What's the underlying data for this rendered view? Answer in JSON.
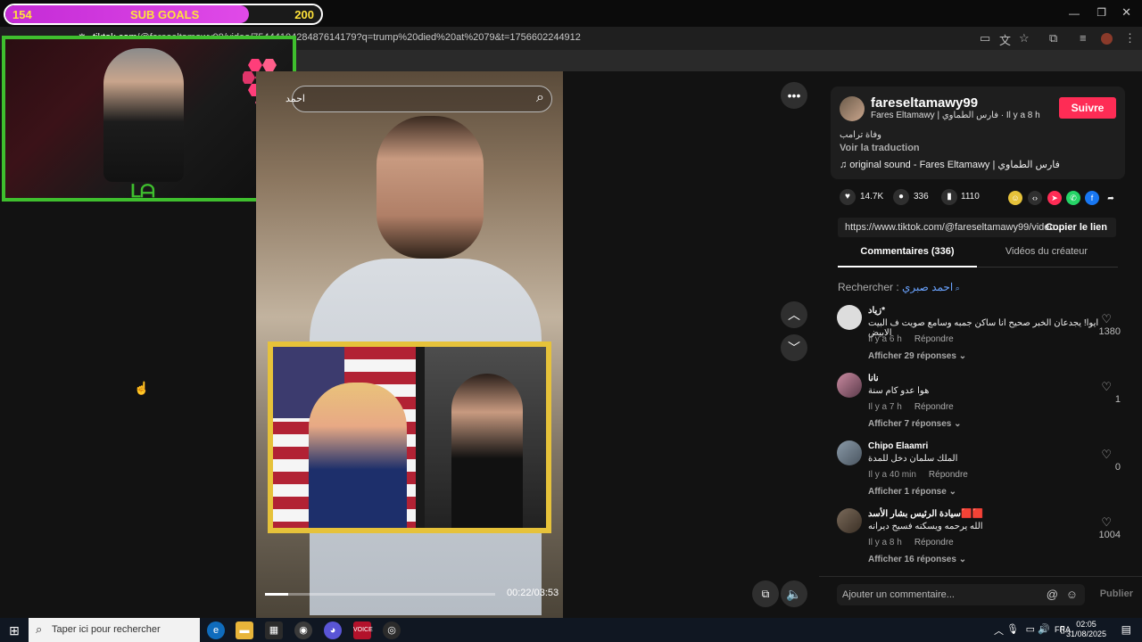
{
  "subgoals": {
    "current": "154",
    "label": "SUB GOALS",
    "goal": "200",
    "progress": 0.77
  },
  "browser": {
    "url_host": "tiktok.com",
    "url_path": "/@fareseltamawy99/video/7544410428487614179?q=trump%20died%20at%2079&t=1756602244912"
  },
  "video_search": {
    "placeholder": "احمد",
    "icon": "search-icon"
  },
  "video": {
    "time": "00:22/03:53",
    "progress": 0.1
  },
  "author": {
    "username": "fareseltamawy99",
    "meta": "Fares Eltamawy | فارس الطماوي · Il y a 8 h",
    "follow": "Suivre",
    "description": "وفاة ترامب",
    "translate": "Voir la traduction",
    "sound": "♫  original sound - Fares Eltamawy | فارس الطماوي"
  },
  "stats": {
    "likes": "14.7K",
    "comments": "336",
    "saves": "1110"
  },
  "share": {
    "link": "https://www.tiktok.com/@fareseltamawy99/video...",
    "copy": "Copier le lien"
  },
  "tabs": {
    "comments": "Commentaires (336)",
    "videos": "Vidéos du créateur"
  },
  "search_prefix": "Rechercher : ",
  "search_term": "احمد صبري",
  "comments": [
    {
      "name": "زياد*",
      "text": "ايوا! يجدعان الخبر صحيح انا ساكن جمبه وسامع صويت ف البيت الابيض",
      "time": "Il y a 6 h",
      "reply": "Répondre",
      "more": "Afficher 29 réponses ⌄",
      "likes": "1380"
    },
    {
      "name": "نانا",
      "text": "هوا عدو كام سنة",
      "time": "Il y a 7 h",
      "reply": "Répondre",
      "more": "Afficher 7 réponses ⌄",
      "likes": "1"
    },
    {
      "name": "Chipo Elaamri",
      "text": "الملك سلمان دخل للمدة",
      "time": "Il y a 40 min",
      "reply": "Répondre",
      "more": "Afficher 1 réponse ⌄",
      "likes": "0"
    },
    {
      "name": "سيادة الرئيس بشار الأسد🟥🟥",
      "text": "الله يرحمه ويسكنه فسيح ديرانه",
      "time": "Il y a 8 h",
      "reply": "Répondre",
      "more": "Afficher 16 réponses ⌄",
      "likes": "1004"
    }
  ],
  "add_comment": {
    "placeholder": "Ajouter un commentaire...",
    "post": "Publier"
  },
  "taskbar": {
    "search_placeholder": "Taper ici pour rechercher",
    "lang": "FRA",
    "time": "02:05",
    "date": "31/08/2025"
  },
  "colors": {
    "accent": "#fe2c55",
    "overlay_green": "#3fbf2e",
    "goal_purple": "#c42bd6",
    "goal_text": "#ffe23a"
  }
}
